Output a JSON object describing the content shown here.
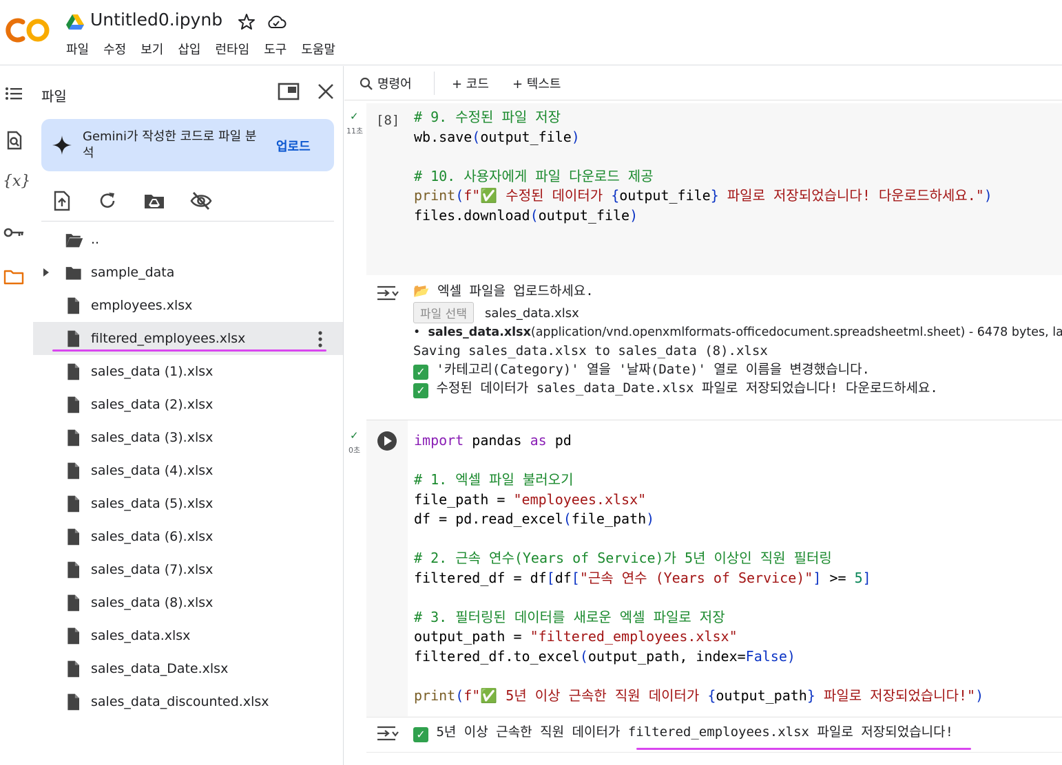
{
  "header": {
    "title": "Untitled0.ipynb",
    "menu": [
      "파일",
      "수정",
      "보기",
      "삽입",
      "런타임",
      "도구",
      "도움말"
    ],
    "colors": {
      "logo_orange": "#f9ab00",
      "logo_dark": "#e8710a"
    }
  },
  "panel": {
    "title": "파일",
    "gemini_text": "Gemini가 작성한 코드로 파일 분석",
    "gemini_button": "업로드",
    "files": [
      {
        "name": "..",
        "type": "folder-open",
        "selected": false
      },
      {
        "name": "sample_data",
        "type": "folder",
        "selected": false
      },
      {
        "name": "employees.xlsx",
        "type": "file",
        "selected": false
      },
      {
        "name": "filtered_employees.xlsx",
        "type": "file",
        "selected": true
      },
      {
        "name": "sales_data (1).xlsx",
        "type": "file",
        "selected": false
      },
      {
        "name": "sales_data (2).xlsx",
        "type": "file",
        "selected": false
      },
      {
        "name": "sales_data (3).xlsx",
        "type": "file",
        "selected": false
      },
      {
        "name": "sales_data (4).xlsx",
        "type": "file",
        "selected": false
      },
      {
        "name": "sales_data (5).xlsx",
        "type": "file",
        "selected": false
      },
      {
        "name": "sales_data (6).xlsx",
        "type": "file",
        "selected": false
      },
      {
        "name": "sales_data (7).xlsx",
        "type": "file",
        "selected": false
      },
      {
        "name": "sales_data (8).xlsx",
        "type": "file",
        "selected": false
      },
      {
        "name": "sales_data.xlsx",
        "type": "file",
        "selected": false
      },
      {
        "name": "sales_data_Date.xlsx",
        "type": "file",
        "selected": false
      },
      {
        "name": "sales_data_discounted.xlsx",
        "type": "file",
        "selected": false
      }
    ]
  },
  "toolbar": {
    "commands": "명령어",
    "add_code": "+ 코드",
    "add_text": "+ 텍스트"
  },
  "cell1": {
    "exec_count": "[8]",
    "exec_time": "11초",
    "lines": {
      "l1": "# 9. 수정된 파일 저장",
      "l2a": "wb.save",
      "l2b": "(",
      "l2c": "output_file",
      "l2d": ")",
      "l4": "# 10. 사용자에게 파일 다운로드 제공",
      "l5a": "print",
      "l5b": "(",
      "l5c": "f\"✅ 수정된 데이터가 ",
      "l5d": "{",
      "l5e": "output_file",
      "l5f": "}",
      "l5g": " 파일로 저장되었습니다! 다운로드하세요.\"",
      "l5h": ")",
      "l6a": "files.download",
      "l6b": "(",
      "l6c": "output_file",
      "l6d": ")"
    },
    "output": {
      "o1": "📂 엑셀 파일을 업로드하세요.",
      "file_button": "파일 선택",
      "file_chosen": "sales_data.xlsx",
      "bullet_name": "sales_data.xlsx",
      "bullet_rest": "(application/vnd.openxmlformats-officedocument.spreadsheetml.sheet) - 6478 bytes, la",
      "o3": "Saving sales_data.xlsx to sales_data (8).xlsx",
      "o4": "'카테고리(Category)' 열을 '날짜(Date)' 열로 이름을 변경했습니다.",
      "o5a": "수정된 데이터가 ",
      "o5b": "sales_data_Date.xlsx",
      "o5c": " 파일로 저장되었습니다! 다운로드하세요."
    }
  },
  "cell2": {
    "exec_time": "0초",
    "lines": {
      "l1a": "import",
      "l1b": " pandas ",
      "l1c": "as",
      "l1d": " pd",
      "l3": "# 1. 엑셀 파일 불러오기",
      "l4a": "file_path = ",
      "l4b": "\"employees.xlsx\"",
      "l5a": "df = pd.read_excel",
      "l5b": "(",
      "l5c": "file_path",
      "l5d": ")",
      "l7": "# 2. 근속 연수(Years of Service)가 5년 이상인 직원 필터링",
      "l8a": "filtered_df = df",
      "l8b": "[",
      "l8c": "df",
      "l8d": "[",
      "l8e": "\"근속 연수 (Years of Service)\"",
      "l8f": "]",
      "l8g": " >= ",
      "l8h": "5",
      "l8i": "]",
      "l10": "# 3. 필터링된 데이터를 새로운 엑셀 파일로 저장",
      "l11a": "output_path = ",
      "l11b": "\"filtered_employees.xlsx\"",
      "l12a": "filtered_df.to_excel",
      "l12b": "(",
      "l12c": "output_path, index=",
      "l12d": "False",
      "l12e": ")",
      "l14a": "print",
      "l14b": "(",
      "l14c": "f\"✅ 5년 이상 근속한 직원 데이터가 ",
      "l14d": "{",
      "l14e": "output_path",
      "l14f": "}",
      "l14g": " 파일로 저장되었습니다!\"",
      "l14h": ")"
    },
    "output": {
      "a": "5년 이상 근속한 직원 데이터가 ",
      "b": "filtered_employees.xlsx",
      "c": " 파일로 저장되었습니다!"
    }
  }
}
